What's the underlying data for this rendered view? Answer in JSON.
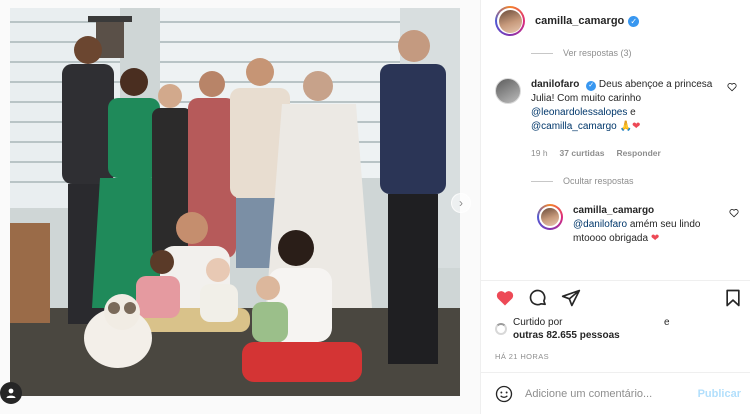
{
  "post": {
    "author": {
      "username": "camilla_camargo",
      "verified": true
    }
  },
  "thread": {
    "view_replies": "Ver respostas (3)",
    "comment": {
      "username": "danilofaro",
      "verified": true,
      "text_before": "Deus abençoe a princesa Julia! Com muito carinho ",
      "mention1": "@leonardolessalopes",
      "text_mid": " e ",
      "mention2": "@camilla_camargo",
      "emoji": "🙏❤",
      "time": "19 h",
      "likes": "37 curtidas",
      "reply": "Responder"
    },
    "hide_replies": "Ocultar respostas",
    "reply_comment": {
      "username": "camilla_camargo",
      "mention": "@danilofaro",
      "text": " amém seu lindo mtoooo obrigada",
      "emoji": "❤"
    }
  },
  "likes": {
    "prefix": "Curtido por",
    "suffix": "e",
    "others": "outras 82.655 pessoas"
  },
  "time_ago": "HÁ 21 HORAS",
  "add_comment": {
    "placeholder": "Adicione um comentário...",
    "post_label": "Publicar"
  },
  "icons": {
    "like": "heart-filled-icon",
    "comment": "comment-icon",
    "share": "direct-share-icon",
    "save": "bookmark-icon",
    "emoji": "emoji-icon",
    "next": "chevron-right-icon",
    "tag": "user-tag-icon"
  },
  "colors": {
    "like_red": "#ed4956",
    "link_blue": "#00376b",
    "post_disabled": "#b2dffc",
    "verified_blue": "#3897f0"
  }
}
